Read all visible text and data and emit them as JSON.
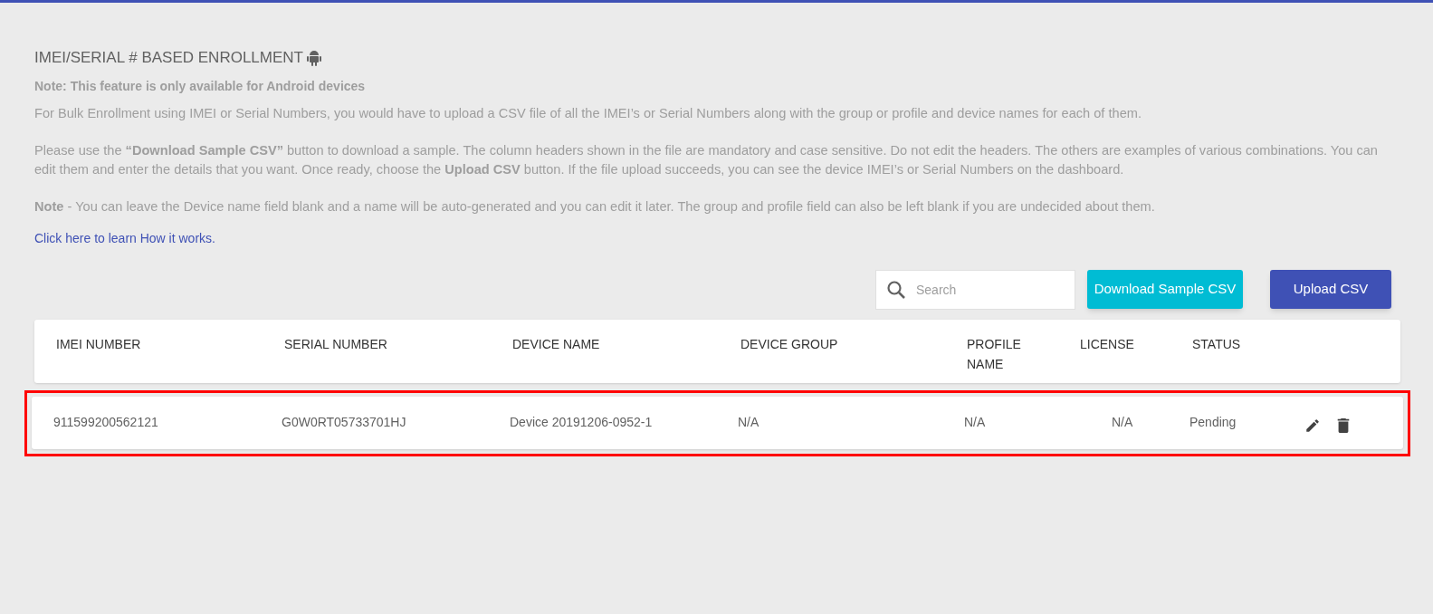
{
  "heading": {
    "title": "IMEI/SERIAL # BASED ENROLLMENT"
  },
  "note": "Note: This feature is only available for Android devices",
  "paragraphs": [
    "For Bulk Enrollment using IMEI or Serial Numbers, you would have to upload a CSV file of all the IMEI’s or Serial Numbers along with the group or profile and device names for each of them.",
    "Please use the **“Download Sample CSV”** button to download a sample. The column headers shown in the file are mandatory and case sensitive. Do not edit the headers. The others are examples of various combinations. You can edit them and enter the details that you want. Once ready, choose the **Upload CSV** button. If the file upload succeeds, you can see the device IMEI’s or Serial Numbers on the dashboard.",
    "**Note** - You can leave the Device name field blank and a name will be auto-generated and you can edit it later. The group and profile field can also be left blank if you are undecided about them."
  ],
  "link": "Click here to learn How it works.",
  "toolbar": {
    "search": {
      "placeholder": "Search"
    },
    "buttons": [
      {
        "label": "Download Sample CSV",
        "kind": "secondary"
      },
      {
        "label": "Upload CSV",
        "kind": "primary"
      }
    ]
  },
  "table": {
    "columns": [
      "IMEI NUMBER",
      "SERIAL NUMBER",
      "DEVICE NAME",
      "DEVICE GROUP",
      "PROFILE NAME",
      "LICENSE",
      "STATUS"
    ],
    "rows": [
      {
        "cells": [
          "911599200562121",
          "G0W0RT05733701HJ",
          "Device 20191206-0952-1",
          "N/A",
          "N/A",
          "N/A",
          "Pending"
        ],
        "highlighted": true
      }
    ]
  }
}
